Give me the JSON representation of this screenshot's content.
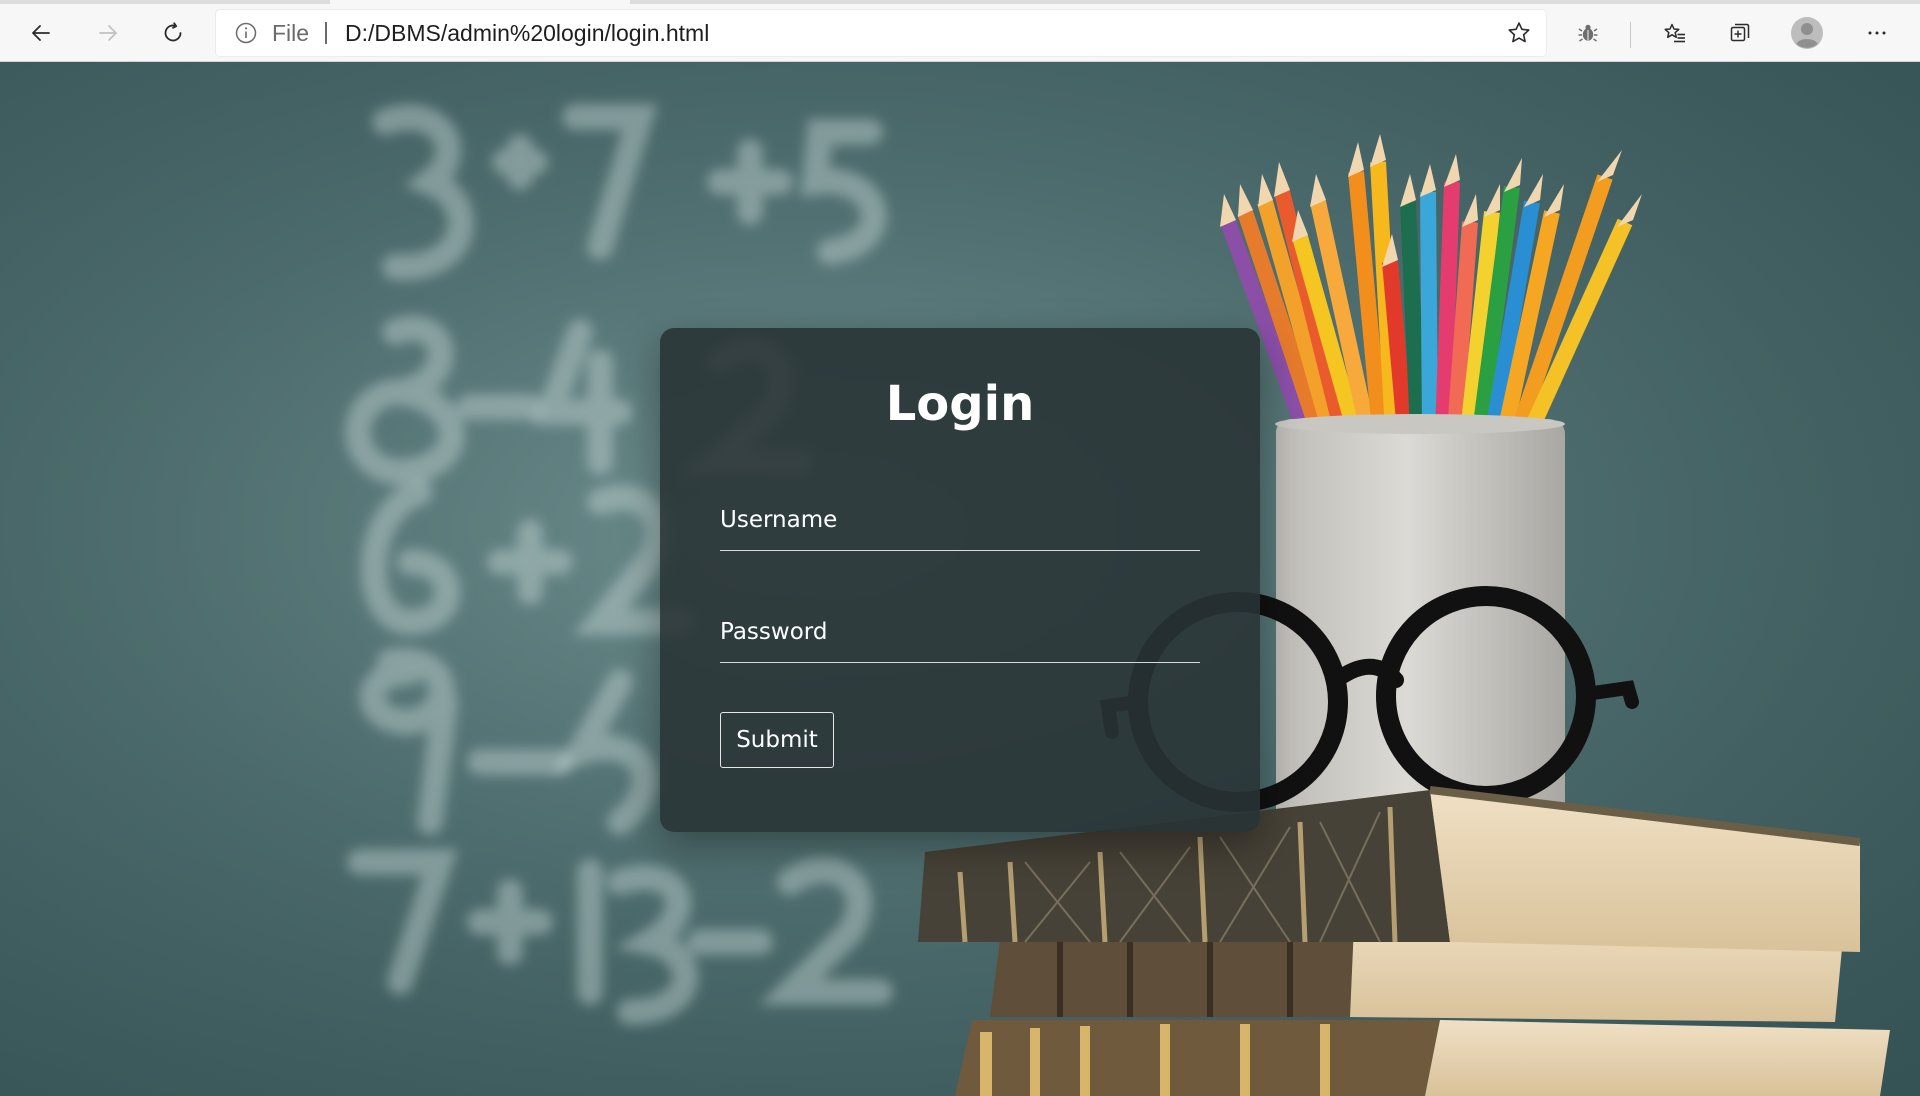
{
  "browser": {
    "address_scheme": "File",
    "address_url": "D:/DBMS/admin%20login/login.html",
    "icons": [
      "back-arrow-icon",
      "forward-arrow-icon",
      "refresh-icon",
      "info-icon",
      "star-icon",
      "extension-icon",
      "favorites-icon",
      "collections-icon",
      "profile-icon",
      "more-icon"
    ]
  },
  "login": {
    "title": "Login",
    "username_placeholder": "Username",
    "password_placeholder": "Password",
    "submit_label": "Submit"
  },
  "colors": {
    "card_background": "#283234",
    "chalkboard": "#5b7e7f",
    "text": "#ffffff"
  }
}
